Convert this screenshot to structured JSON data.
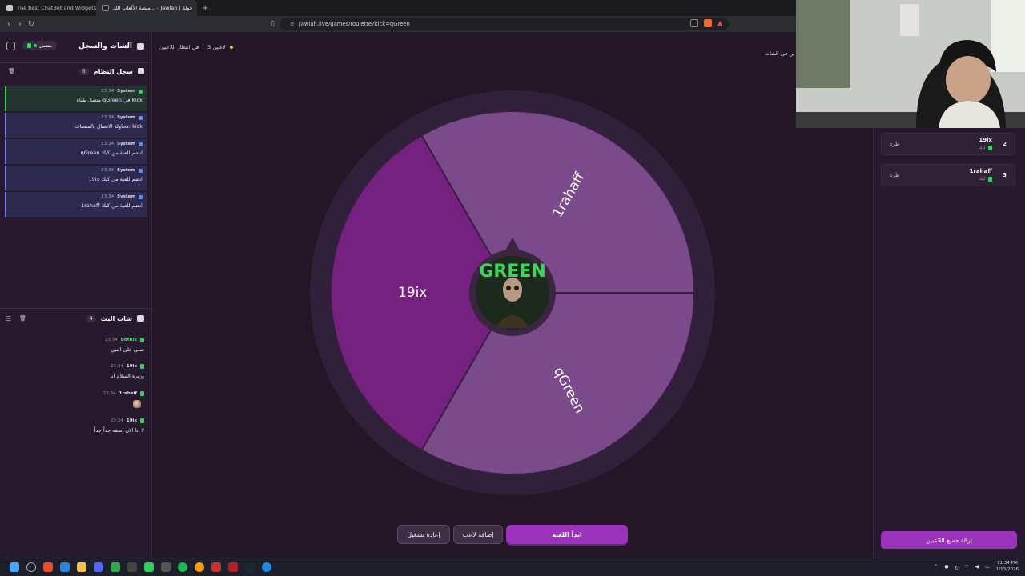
{
  "browser": {
    "tabs": [
      {
        "title": "The best ChatBot and Widgets for Ki..."
      },
      {
        "title": "منصة الألعاب الك... - Jawlah | جولة"
      }
    ],
    "url": "jawlah.live/games/roulette?kick=qGreen"
  },
  "left_panel": {
    "title": "الشات والسجل",
    "connection_status": "متصل",
    "system_log": {
      "title": "سجل النظام",
      "count": "5",
      "items": [
        {
          "source": "System",
          "time": "23:34",
          "message": "متصل بقناة qGreen في Kick",
          "type": "kick"
        },
        {
          "source": "System",
          "time": "23:34",
          "message": "محاولة الاتصال بالمنصات: kick",
          "type": "info"
        },
        {
          "source": "System",
          "time": "23:34",
          "message": "qGreen انضم للعبة من كيك",
          "type": "info"
        },
        {
          "source": "System",
          "time": "23:34",
          "message": "19ix انضم للعبة من كيك",
          "type": "info"
        },
        {
          "source": "System",
          "time": "23:34",
          "message": "1rahaff انضم للعبة من كيك",
          "type": "info"
        }
      ]
    },
    "live_chat": {
      "title": "شات البث",
      "count": "4",
      "messages": [
        {
          "user": "BotRix",
          "time": "23:34",
          "text": "صلي على النبي"
        },
        {
          "user": "19ix",
          "time": "23:34",
          "text": "وزيرة السلام انا"
        },
        {
          "user": "1rahaff",
          "time": "23:34",
          "text": ""
        },
        {
          "user": "19ix",
          "time": "23:34",
          "text": "لا انا الان اسفه جداً جداً"
        }
      ]
    }
  },
  "center": {
    "waiting_label": "في انتظار اللاعبين",
    "players_count": "3 لاعبين",
    "chat_entry_label": "ين في الشات",
    "wheel": {
      "segments": [
        {
          "label": "1rahaff",
          "color": "#7a4a8b"
        },
        {
          "label": "qGreen",
          "color": "#7a4a8b"
        },
        {
          "label": "19ix",
          "color": "#74217f"
        }
      ],
      "center_logo_text": "GREEN"
    },
    "buttons": {
      "restart": "إعادة تشغيل",
      "add_player": "إضافة لاعب",
      "start": "ابدأ اللعبة"
    }
  },
  "right_panel": {
    "players": [
      {
        "rank": "2",
        "name": "19ix",
        "platform": "كيك",
        "action": "طرد"
      },
      {
        "rank": "3",
        "name": "1rahaff",
        "platform": "كيك",
        "action": "طرد"
      }
    ],
    "remove_all": "إزالة جميع اللاعبين"
  },
  "taskbar": {
    "time": "11:34 PM",
    "date": "1/13/2026",
    "lang": "ع"
  },
  "colors": {
    "accent": "#9c33bd",
    "kick_green": "#2fd15a",
    "background": "#221627"
  }
}
